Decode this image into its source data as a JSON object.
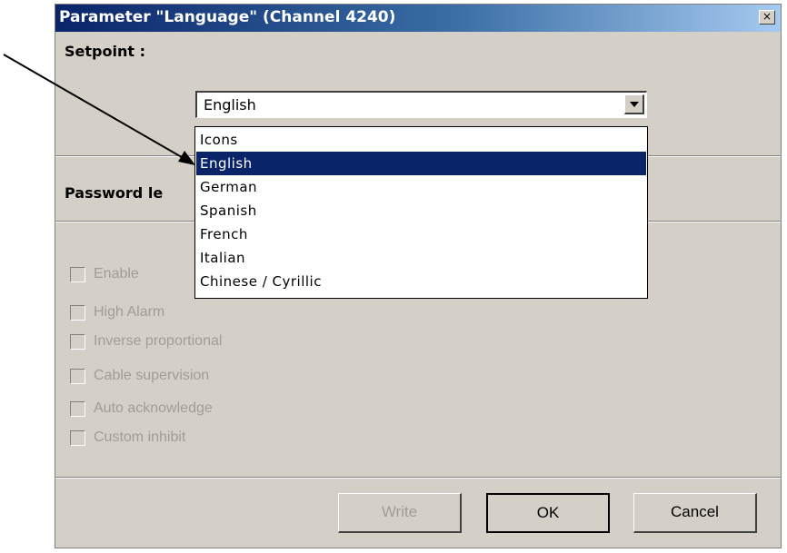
{
  "window": {
    "title": "Parameter \"Language\" (Channel 4240)",
    "close_label": "×"
  },
  "setpoint": {
    "label": "Setpoint :",
    "selected_value": "English"
  },
  "dropdown": {
    "options": [
      "Icons",
      "English",
      "German",
      "Spanish",
      "French",
      "Italian",
      "Chinese / Cyrillic"
    ],
    "selected_index": 1
  },
  "password": {
    "label_visible": "Password le"
  },
  "checkboxes": [
    {
      "label": "Enable",
      "checked": false,
      "enabled": false
    },
    {
      "label": "High Alarm",
      "checked": false,
      "enabled": false
    },
    {
      "label": "Inverse proportional",
      "checked": false,
      "enabled": false
    },
    {
      "label": "Cable supervision",
      "checked": false,
      "enabled": false
    },
    {
      "label": "Auto acknowledge",
      "checked": false,
      "enabled": false
    },
    {
      "label": "Custom inhibit",
      "checked": false,
      "enabled": false
    }
  ],
  "buttons": {
    "write": "Write",
    "ok": "OK",
    "cancel": "Cancel"
  },
  "colors": {
    "title_bar_start": "#0a246a",
    "title_bar_end": "#a6caf0",
    "dialog_face": "#d4d0c8",
    "selection": "#0a246a",
    "disabled_text": "#a09d96"
  }
}
